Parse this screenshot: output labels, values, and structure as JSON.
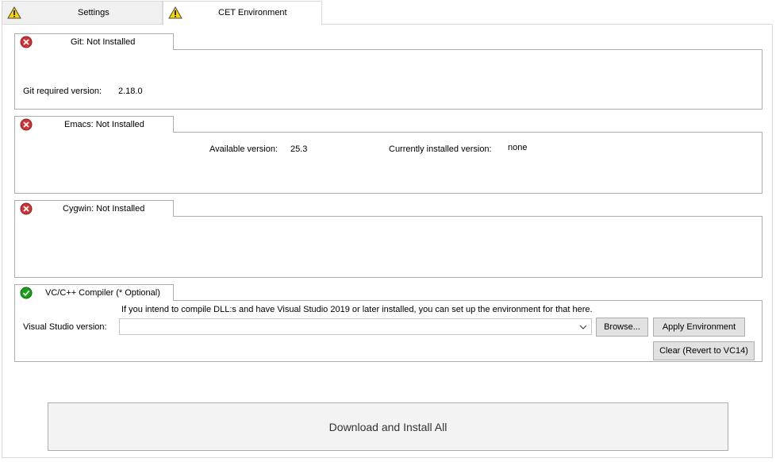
{
  "tabs": [
    {
      "label": "Settings",
      "icon": "warning-icon"
    },
    {
      "label": "CET Environment",
      "icon": "warning-icon",
      "active": true
    }
  ],
  "git": {
    "title": "Git: Not Installed",
    "status": "error",
    "required_label": "Git required version:",
    "required_value": "2.18.0"
  },
  "emacs": {
    "title": "Emacs: Not Installed",
    "status": "error",
    "available_label": "Available version:",
    "available_value": "25.3",
    "installed_label": "Currently installed version:",
    "installed_value": "none"
  },
  "cygwin": {
    "title": "Cygwin: Not Installed",
    "status": "error"
  },
  "vc": {
    "title": "VC/C++ Compiler (* Optional)",
    "status": "ok",
    "info": "If you intend to compile DLL:s and have Visual Studio 2019 or later installed, you can set up the environment for that here.",
    "vs_label": "Visual Studio version:",
    "vs_value": "",
    "browse_label": "Browse...",
    "apply_label": "Apply Environment",
    "clear_label": "Clear (Revert to VC14)"
  },
  "download_all_label": "Download and Install All",
  "colors": {
    "error": "#d13438",
    "ok": "#16a016",
    "warning": "#f6d500"
  }
}
